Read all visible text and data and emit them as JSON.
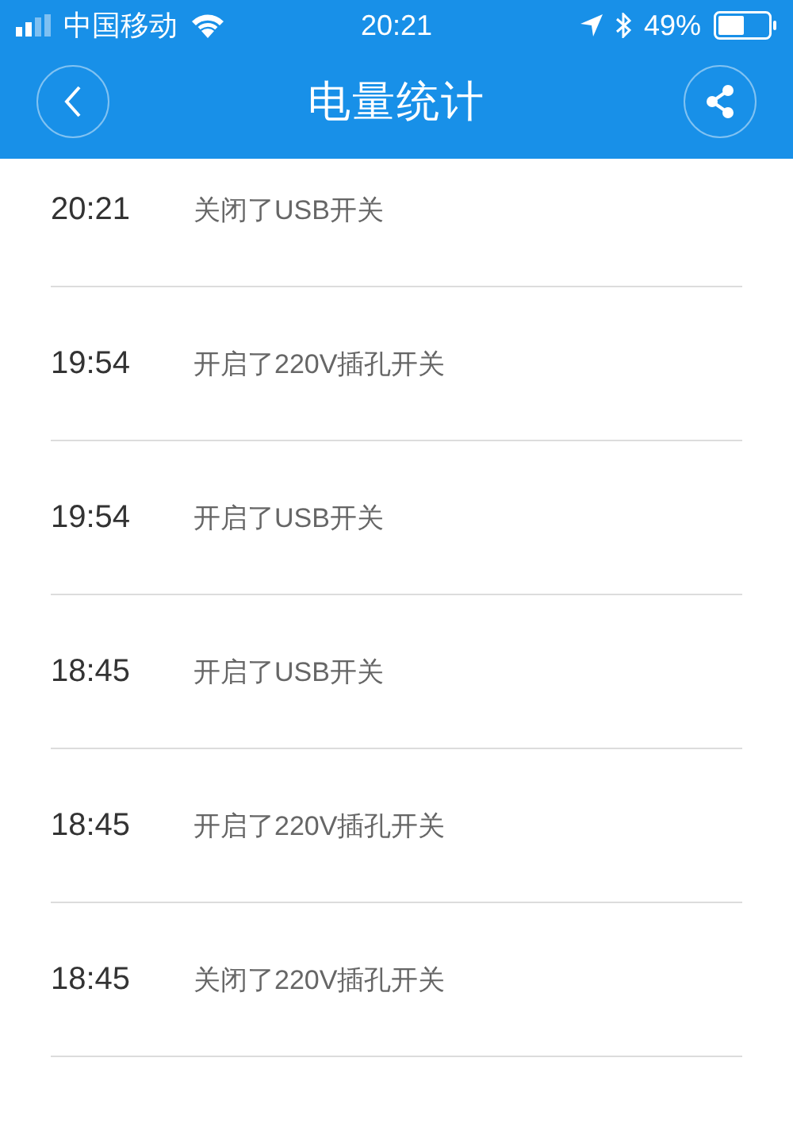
{
  "status_bar": {
    "carrier": "中国移动",
    "time": "20:21",
    "battery": "49%"
  },
  "nav_bar": {
    "title": "电量统计"
  },
  "records": [
    {
      "time": "20:21",
      "action": "关闭了USB开关"
    },
    {
      "time": "19:54",
      "action": "开启了220V插孔开关"
    },
    {
      "time": "19:54",
      "action": "开启了USB开关"
    },
    {
      "time": "18:45",
      "action": "开启了USB开关"
    },
    {
      "time": "18:45",
      "action": "开启了220V插孔开关"
    },
    {
      "time": "18:45",
      "action": "关闭了220V插孔开关"
    }
  ]
}
